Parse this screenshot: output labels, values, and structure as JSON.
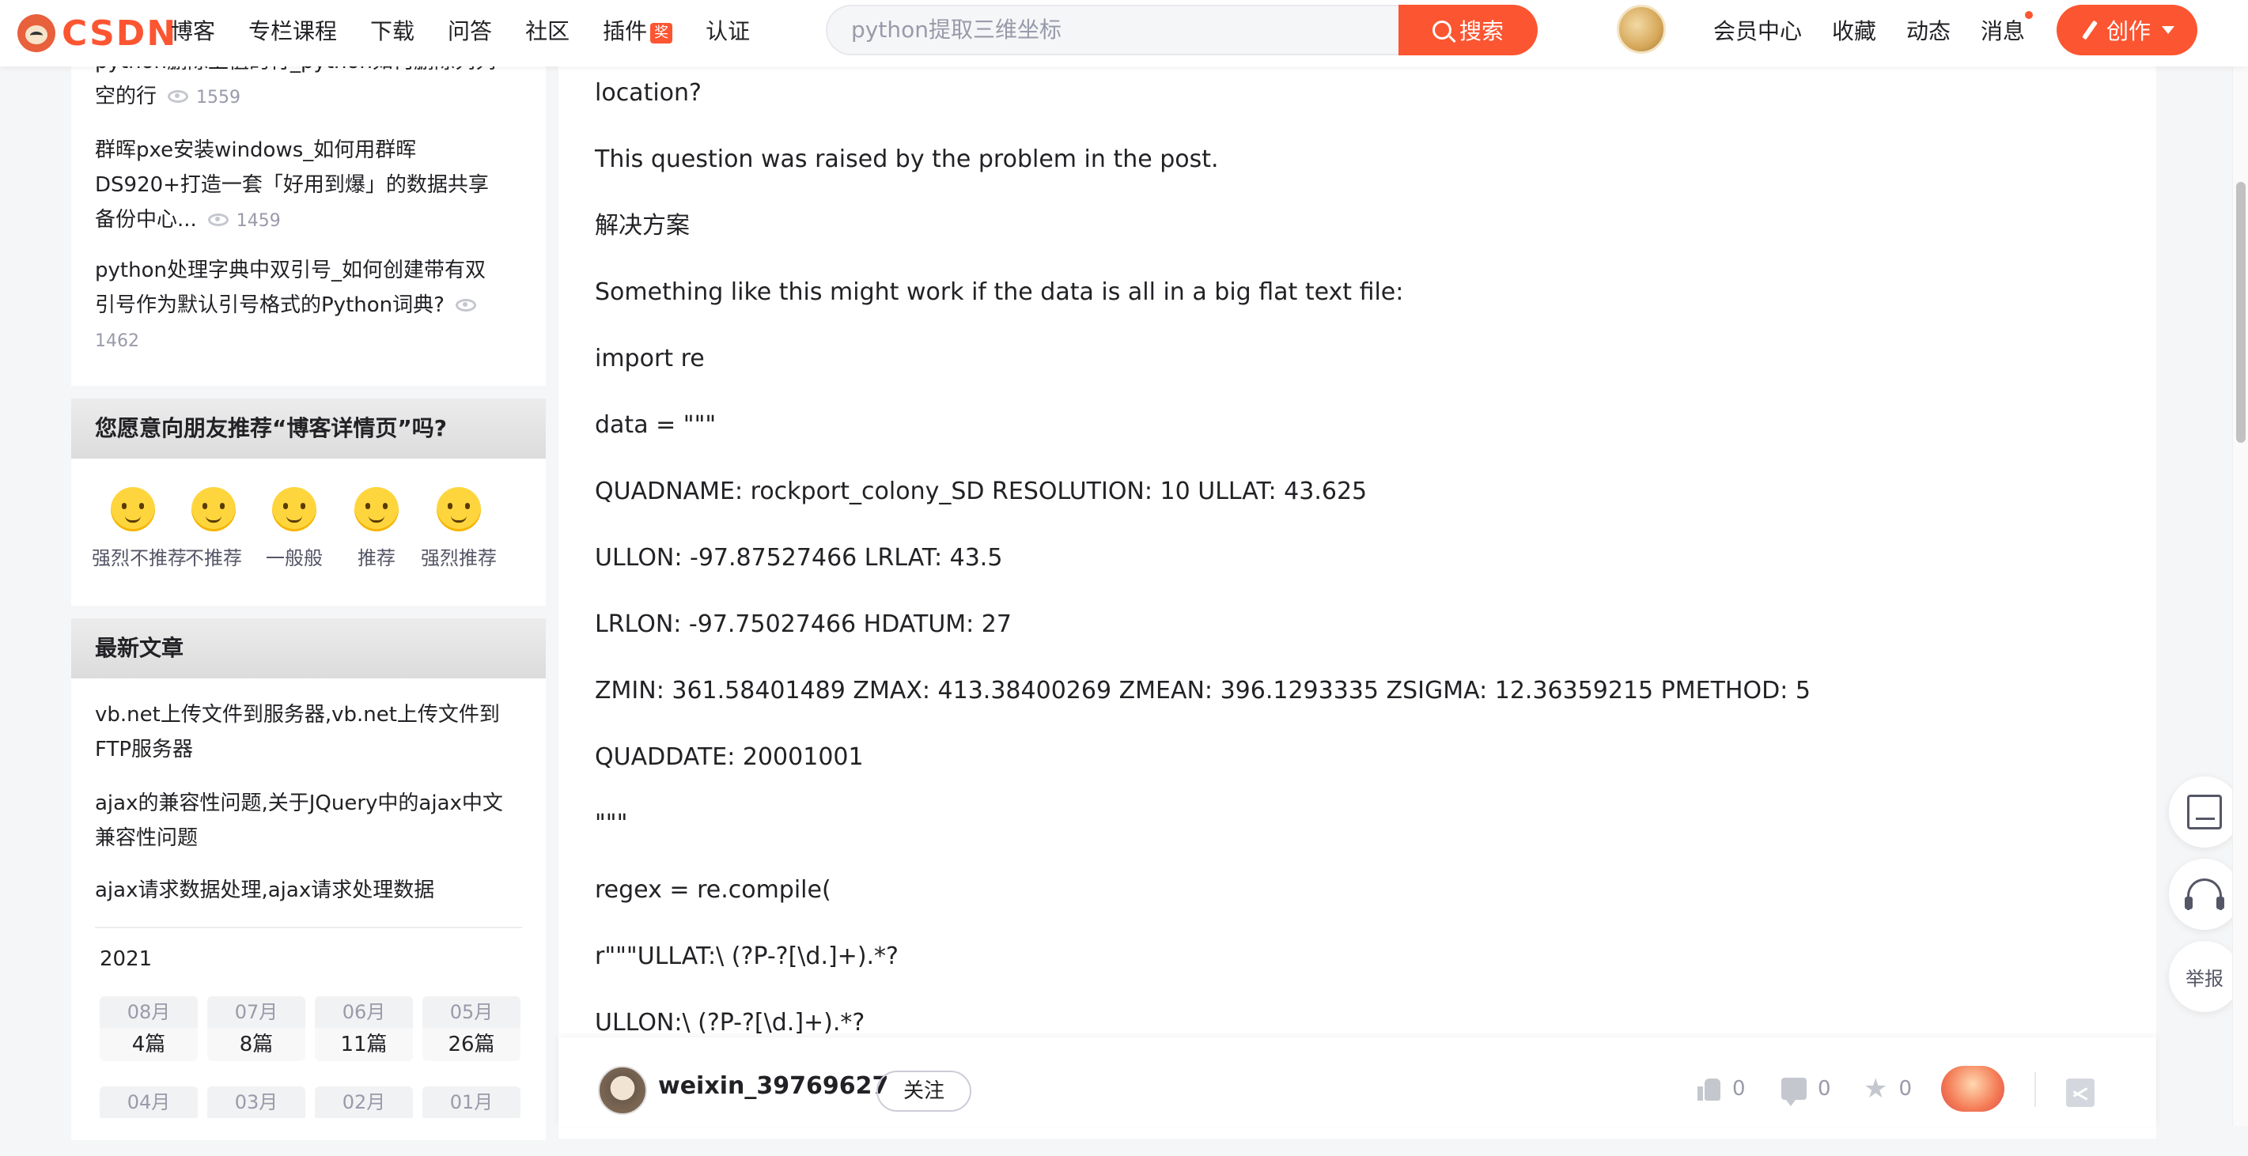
{
  "header": {
    "logo_text": "CSDN",
    "nav": [
      "博客",
      "专栏课程",
      "下载",
      "问答",
      "社区",
      "插件",
      "认证"
    ],
    "plugin_badge": "奖",
    "search_placeholder": "python提取三维坐标",
    "search_button": "搜索",
    "right_nav": [
      "会员中心",
      "收藏",
      "动态",
      "消息"
    ],
    "create_button": "创作"
  },
  "sidebar": {
    "hot_articles": [
      {
        "title_line1": "python删除上值的行_python如何删除列列",
        "title_line2": "空的行",
        "views": "1559"
      },
      {
        "title_line1": "群晖pxe安装windows_如何用群晖",
        "title_line2": "DS920+打造一套「好用到爆」的数据共享",
        "title_line3": "备份中心...",
        "views": "1459"
      },
      {
        "title_line1": "python处理字典中双引号_如何创建带有双",
        "title_line2": "引号作为默认引号格式的Python词典?",
        "views": "1462"
      }
    ],
    "recommend": {
      "title": "您愿意向朋友推荐“博客详情页”吗?",
      "options": [
        "强烈不推荐",
        "不推荐",
        "一般般",
        "推荐",
        "强烈推荐"
      ]
    },
    "latest": {
      "title": "最新文章",
      "articles": [
        {
          "line1": "vb.net上传文件到服务器,vb.net上传文件到",
          "line2": "FTP服务器"
        },
        {
          "line1": "ajax的兼容性问题,关于JQuery中的ajax中文",
          "line2": "兼容性问题"
        },
        {
          "line1": "ajax请求数据处理,ajax请求处理数据"
        }
      ],
      "year": "2021",
      "months": [
        {
          "month": "08月",
          "count": "4篇"
        },
        {
          "month": "07月",
          "count": "8篇"
        },
        {
          "month": "06月",
          "count": "11篇"
        },
        {
          "month": "05月",
          "count": "26篇"
        },
        {
          "month": "04月",
          "count": ""
        },
        {
          "month": "03月",
          "count": ""
        },
        {
          "month": "02月",
          "count": ""
        },
        {
          "month": "01月",
          "count": ""
        }
      ]
    }
  },
  "article": {
    "lines": [
      "location?",
      "This question was raised by the problem in the post.",
      "解决方案",
      "Something like this might work if the data is all in a big flat text file:",
      "import re",
      "data = \"\"\"",
      "QUADNAME: rockport_colony_SD RESOLUTION: 10 ULLAT: 43.625",
      "ULLON: -97.87527466 LRLAT: 43.5",
      "LRLON: -97.75027466 HDATUM: 27",
      "ZMIN: 361.58401489 ZMAX: 413.38400269 ZMEAN: 396.1293335 ZSIGMA: 12.36359215 PMETHOD: 5",
      "QUADDATE: 20001001",
      "\"\"\"",
      "regex = re.compile(",
      "r\"\"\"ULLAT:\\ (?P-?[\\d.]+).*?",
      "ULLON:\\ (?P-?[\\d.]+).*?"
    ]
  },
  "bottom_bar": {
    "author": "weixin_39769627",
    "follow": "关注",
    "likes": "0",
    "comments": "0",
    "favorites": "0"
  },
  "float_tools": {
    "report": "举报"
  }
}
